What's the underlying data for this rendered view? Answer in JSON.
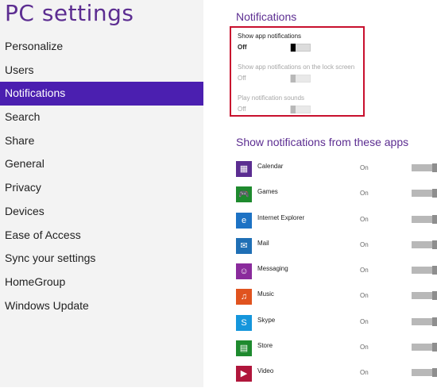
{
  "sidebar": {
    "title": "PC settings",
    "items": [
      {
        "label": "Personalize",
        "active": false
      },
      {
        "label": "Users",
        "active": false
      },
      {
        "label": "Notifications",
        "active": true
      },
      {
        "label": "Search",
        "active": false
      },
      {
        "label": "Share",
        "active": false
      },
      {
        "label": "General",
        "active": false
      },
      {
        "label": "Privacy",
        "active": false
      },
      {
        "label": "Devices",
        "active": false
      },
      {
        "label": "Ease of Access",
        "active": false
      },
      {
        "label": "Sync your settings",
        "active": false
      },
      {
        "label": "HomeGroup",
        "active": false
      },
      {
        "label": "Windows Update",
        "active": false
      }
    ]
  },
  "main": {
    "section_title": "Notifications",
    "options": [
      {
        "label": "Show app notifications",
        "value": "Off",
        "enabled": true
      },
      {
        "label": "Show app notifications on the lock screen",
        "value": "Off",
        "enabled": false
      },
      {
        "label": "Play notification sounds",
        "value": "Off",
        "enabled": false
      }
    ],
    "apps_title": "Show notifications from these apps",
    "apps": [
      {
        "name": "Calendar",
        "state": "On",
        "icon": "calendar-icon",
        "color": "#5b2d91",
        "glyph": "▦"
      },
      {
        "name": "Games",
        "state": "On",
        "icon": "games-icon",
        "color": "#1e8a2e",
        "glyph": "🎮"
      },
      {
        "name": "Internet Explorer",
        "state": "On",
        "icon": "internet-explorer-icon",
        "color": "#1d72c4",
        "glyph": "e"
      },
      {
        "name": "Mail",
        "state": "On",
        "icon": "mail-icon",
        "color": "#1f6fb5",
        "glyph": "✉"
      },
      {
        "name": "Messaging",
        "state": "On",
        "icon": "messaging-icon",
        "color": "#8a2b9c",
        "glyph": "☺"
      },
      {
        "name": "Music",
        "state": "On",
        "icon": "music-icon",
        "color": "#e0531f",
        "glyph": "♫"
      },
      {
        "name": "Skype",
        "state": "On",
        "icon": "skype-icon",
        "color": "#1596dc",
        "glyph": "S"
      },
      {
        "name": "Store",
        "state": "On",
        "icon": "store-icon",
        "color": "#1e8a2e",
        "glyph": "▤"
      },
      {
        "name": "Video",
        "state": "On",
        "icon": "video-icon",
        "color": "#b0163b",
        "glyph": "▶"
      }
    ]
  },
  "colors": {
    "accent": "#5c2d91",
    "nav_active": "#4b1fb0",
    "highlight_border": "#c8102e"
  }
}
